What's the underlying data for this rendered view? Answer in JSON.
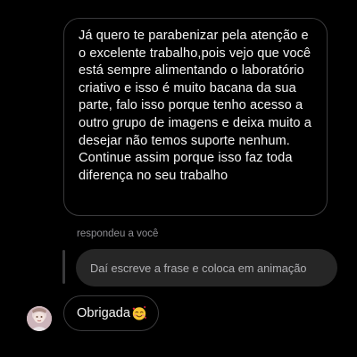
{
  "messages": {
    "received_long": "Já quero te parabenizar pela atenção e o excelente trabalho,pois vejo que você está sempre alimentando o laboratório criativo e isso é muito bacana da sua parte, falo isso porque tenho acesso a outro grupo de imagens e deixa muito a desejar não temos suporte nenhum. Continue assim porque isso faz toda diferença no seu trabalho",
    "reply_label": "respondeu a você",
    "quoted_text": "Daí escreve a frase e coloca em animação",
    "reply_text": "Obrigada",
    "reply_emoji": "smiling-face-with-hearts-icon"
  },
  "colors": {
    "background": "#000000",
    "bubble_border": "#3a3a3c",
    "quoted_bubble": "#262626",
    "secondary_text": "#8e8e93",
    "primary_text": "#f5f5f5"
  }
}
